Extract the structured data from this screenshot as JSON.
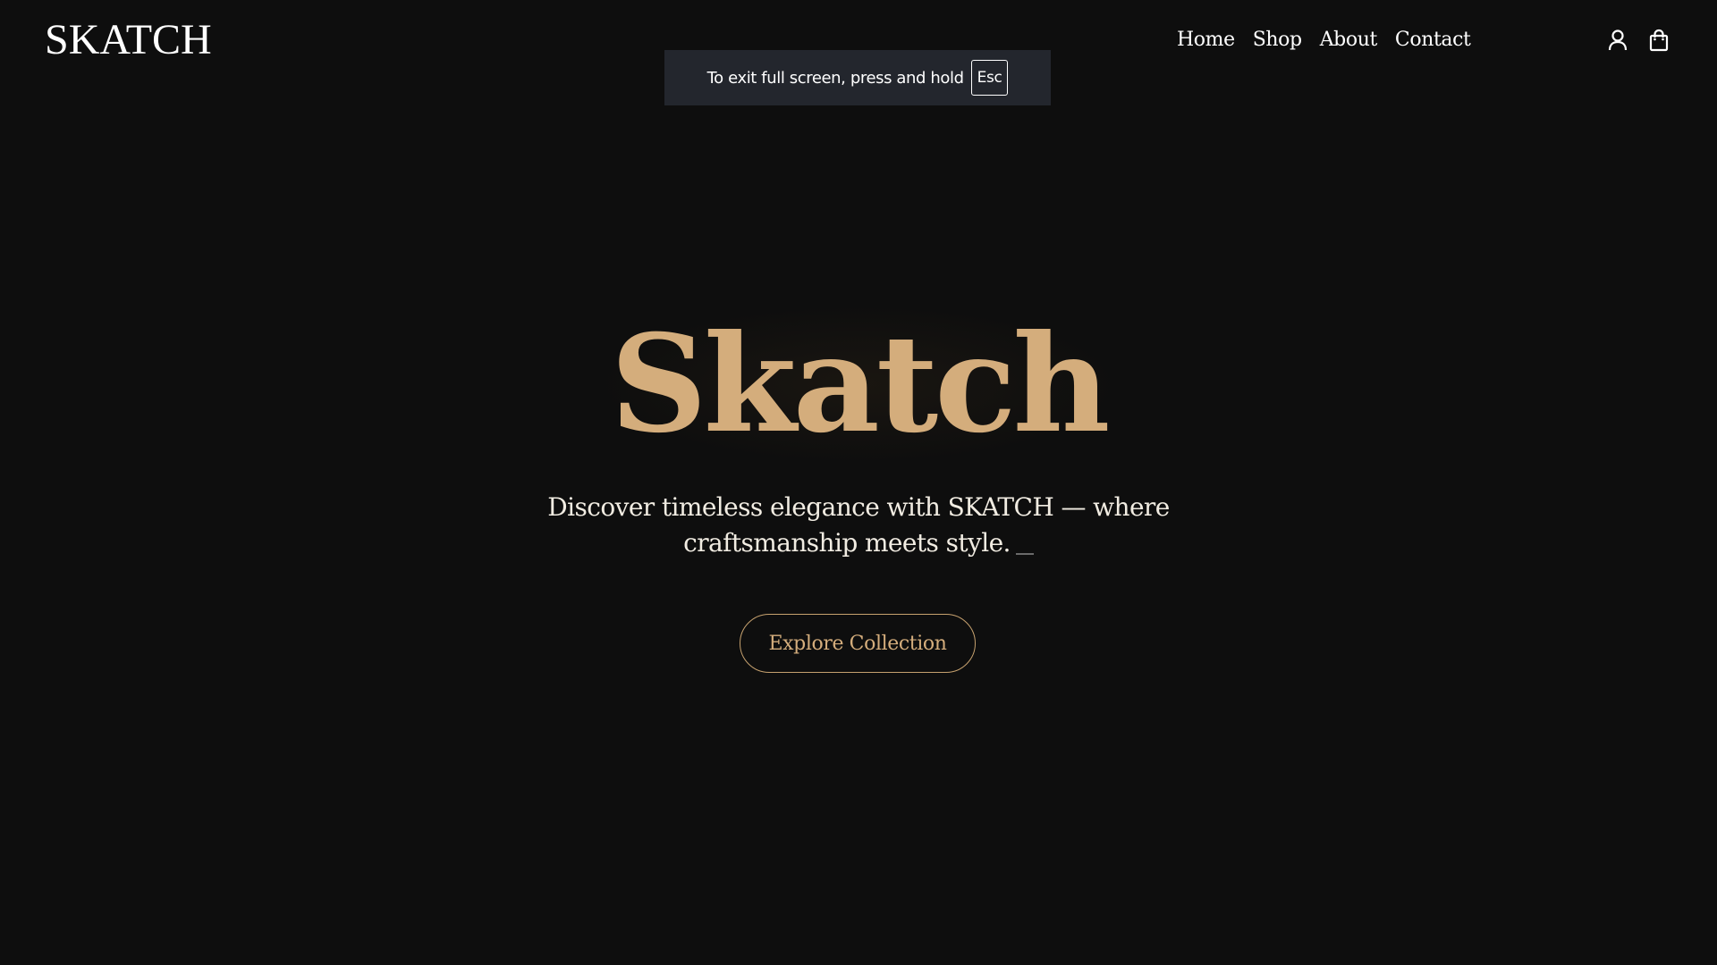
{
  "header": {
    "logo": "SKATCH",
    "nav": [
      "Home",
      "Shop",
      "About",
      "Contact"
    ],
    "icons": [
      "user-icon",
      "shopping-bag-icon"
    ]
  },
  "fullscreen_notice": {
    "message": "To exit full screen, press and hold",
    "key": "Esc"
  },
  "hero": {
    "title": "Skatch",
    "subtitle": "Discover timeless elegance with SKATCH — where craftsmanship meets style.",
    "cta_label": "Explore Collection"
  },
  "colors": {
    "background": "#0e0e0e",
    "accent": "#d4ad7c",
    "text": "#ffffff",
    "toast_bg": "#23262d"
  }
}
